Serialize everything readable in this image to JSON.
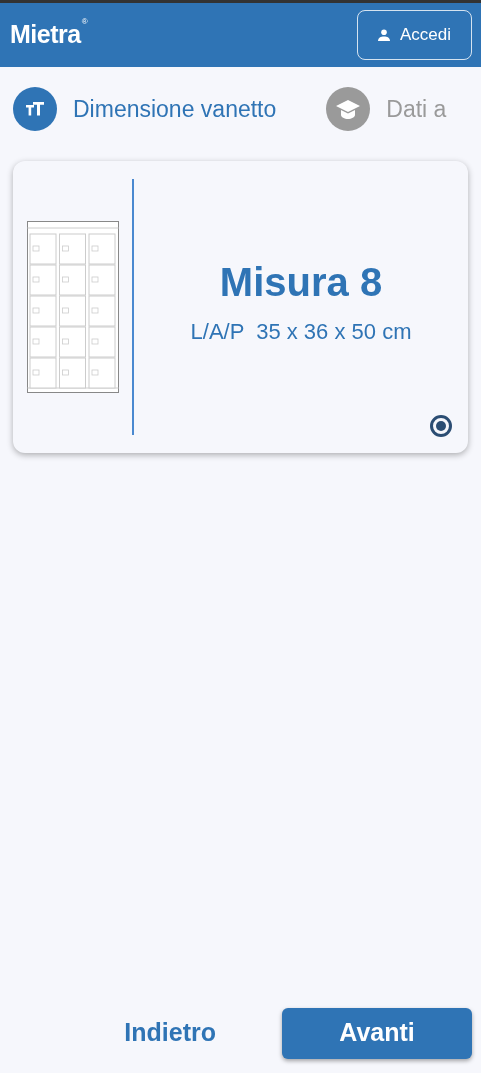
{
  "header": {
    "logo": "Mietra",
    "logo_mark": "®",
    "login_button": "Accedi"
  },
  "steps": [
    {
      "label": "Dimensione vanetto",
      "kind": "text-size",
      "selected": true
    },
    {
      "label": "Dati a",
      "kind": "graduation",
      "selected": false
    }
  ],
  "options": [
    {
      "title": "Misura 8",
      "dimensions": "L/A/P  35 x 36 x 50 cm",
      "selected": true
    }
  ],
  "footer": {
    "back": "Indietro",
    "next": "Avanti"
  }
}
